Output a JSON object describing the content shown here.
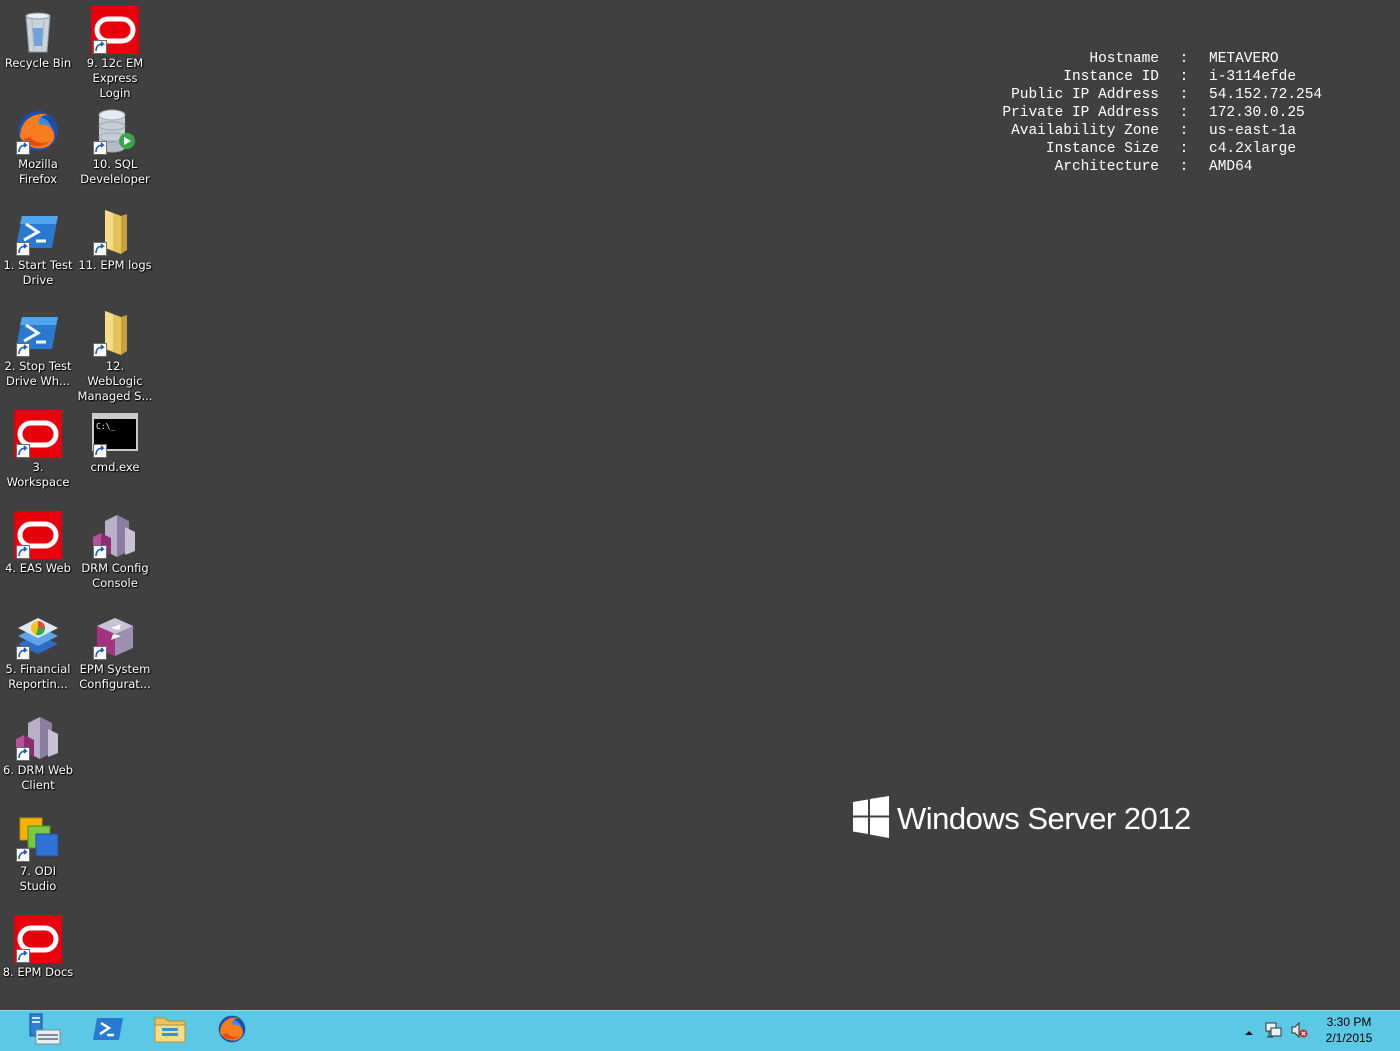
{
  "desktop_icons": [
    {
      "id": "recycle-bin",
      "label": "Recycle Bin",
      "icon": "recycle-bin-icon",
      "shortcut": false
    },
    {
      "id": "em-express",
      "label": "9. 12c EM Express Login",
      "icon": "oracle-icon",
      "shortcut": true
    },
    {
      "id": "firefox",
      "label": "Mozilla Firefox",
      "icon": "firefox-icon",
      "shortcut": true
    },
    {
      "id": "sql-developer",
      "label": "10. SQL Develeloper",
      "icon": "database-icon",
      "shortcut": true
    },
    {
      "id": "start-test-drive",
      "label": "1. Start Test Drive",
      "icon": "powershell-icon",
      "shortcut": true
    },
    {
      "id": "epm-logs",
      "label": "11. EPM logs",
      "icon": "folder-icon",
      "shortcut": true
    },
    {
      "id": "stop-test-drive",
      "label": "2. Stop Test Drive Wh...",
      "icon": "powershell-icon",
      "shortcut": true
    },
    {
      "id": "weblogic-managed",
      "label": "12. WebLogic Managed S...",
      "icon": "folder-icon",
      "shortcut": true
    },
    {
      "id": "workspace",
      "label": "3. Workspace",
      "icon": "oracle-icon",
      "shortcut": true
    },
    {
      "id": "cmd",
      "label": "cmd.exe",
      "icon": "cmd-icon",
      "shortcut": true
    },
    {
      "id": "eas-web",
      "label": "4. EAS Web",
      "icon": "oracle-icon",
      "shortcut": true
    },
    {
      "id": "drm-config",
      "label": "DRM Config Console",
      "icon": "drm-cubes-icon",
      "shortcut": true
    },
    {
      "id": "financial-reporting",
      "label": "5. Financial Reportin...",
      "icon": "financial-reporting-icon",
      "shortcut": true
    },
    {
      "id": "epm-system-config",
      "label": "EPM System Configurat...",
      "icon": "epm-config-icon",
      "shortcut": true
    },
    {
      "id": "drm-web-client",
      "label": "6. DRM Web Client",
      "icon": "drm-cubes-icon",
      "shortcut": true
    },
    {
      "id": "odi-studio",
      "label": "7. ODI Studio",
      "icon": "odi-icon",
      "shortcut": true
    },
    {
      "id": "epm-docs",
      "label": "8. EPM Docs",
      "icon": "oracle-icon",
      "shortcut": true
    }
  ],
  "sysinfo": [
    {
      "key": "Hostname",
      "sep": ":",
      "value": "METAVERO"
    },
    {
      "key": "Instance ID",
      "sep": ":",
      "value": "i-3114efde"
    },
    {
      "key": "Public IP Address",
      "sep": ":",
      "value": "54.152.72.254"
    },
    {
      "key": "Private IP Address",
      "sep": ":",
      "value": "172.30.0.25"
    },
    {
      "key": "Availability Zone",
      "sep": ":",
      "value": "us-east-1a"
    },
    {
      "key": "Instance Size",
      "sep": ":",
      "value": "c4.2xlarge"
    },
    {
      "key": "Architecture",
      "sep": ":",
      "value": "AMD64"
    }
  ],
  "watermark": {
    "text": "Windows Server 2012"
  },
  "taskbar": {
    "pinned": [
      {
        "name": "server-manager-icon"
      },
      {
        "name": "powershell-icon"
      },
      {
        "name": "file-explorer-icon"
      },
      {
        "name": "firefox-icon"
      }
    ],
    "tray_icons": [
      "show-hidden-icons-chevron-icon",
      "network-icon",
      "volume-muted-icon"
    ],
    "clock": {
      "time": "3:30 PM",
      "date": "2/1/2015"
    }
  },
  "colors": {
    "desktop": "#404040",
    "taskbar": "#5bc8e6",
    "oracle_red": "#e8000d"
  }
}
